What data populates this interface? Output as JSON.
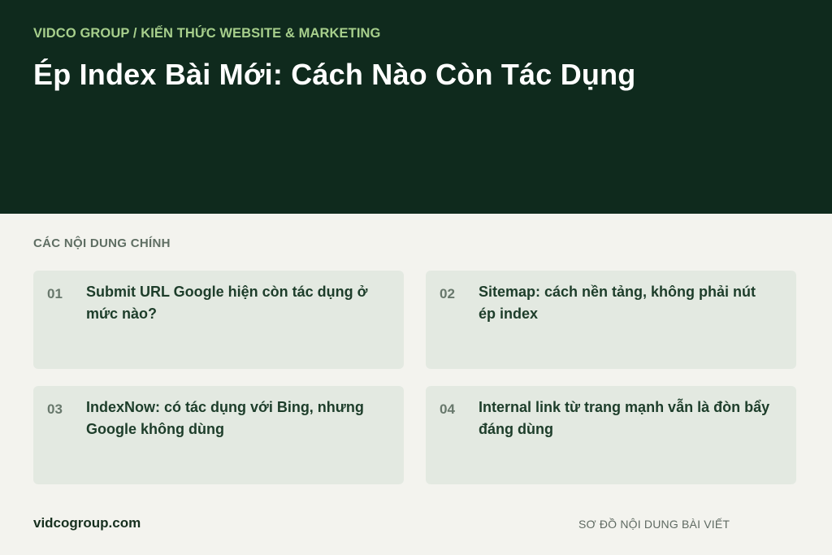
{
  "header": {
    "breadcrumb": "VIDCO GROUP / KIẾN THỨC WEBSITE & MARKETING",
    "title": "Ép Index Bài Mới: Cách Nào Còn Tác Dụng"
  },
  "section": {
    "label": "CÁC NỘI DUNG CHÍNH",
    "items": [
      {
        "number": "01",
        "text": "Submit URL Google hiện còn tác dụng ở mức nào?"
      },
      {
        "number": "02",
        "text": "Sitemap: cách nền tảng, không phải nút ép index"
      },
      {
        "number": "03",
        "text": "IndexNow: có tác dụng với Bing, nhưng Google không dùng"
      },
      {
        "number": "04",
        "text": "Internal link từ trang mạnh vẫn là đòn bẩy đáng dùng"
      }
    ]
  },
  "footer": {
    "site": "vidcogroup.com",
    "caption": "SƠ ĐỒ NỘI DUNG BÀI VIẾT"
  },
  "colors": {
    "hero_background": "#0f2a1d",
    "breadcrumb": "#a7cf8c",
    "card_background": "#e3e9e1",
    "page_background": "#f3f3ee"
  }
}
